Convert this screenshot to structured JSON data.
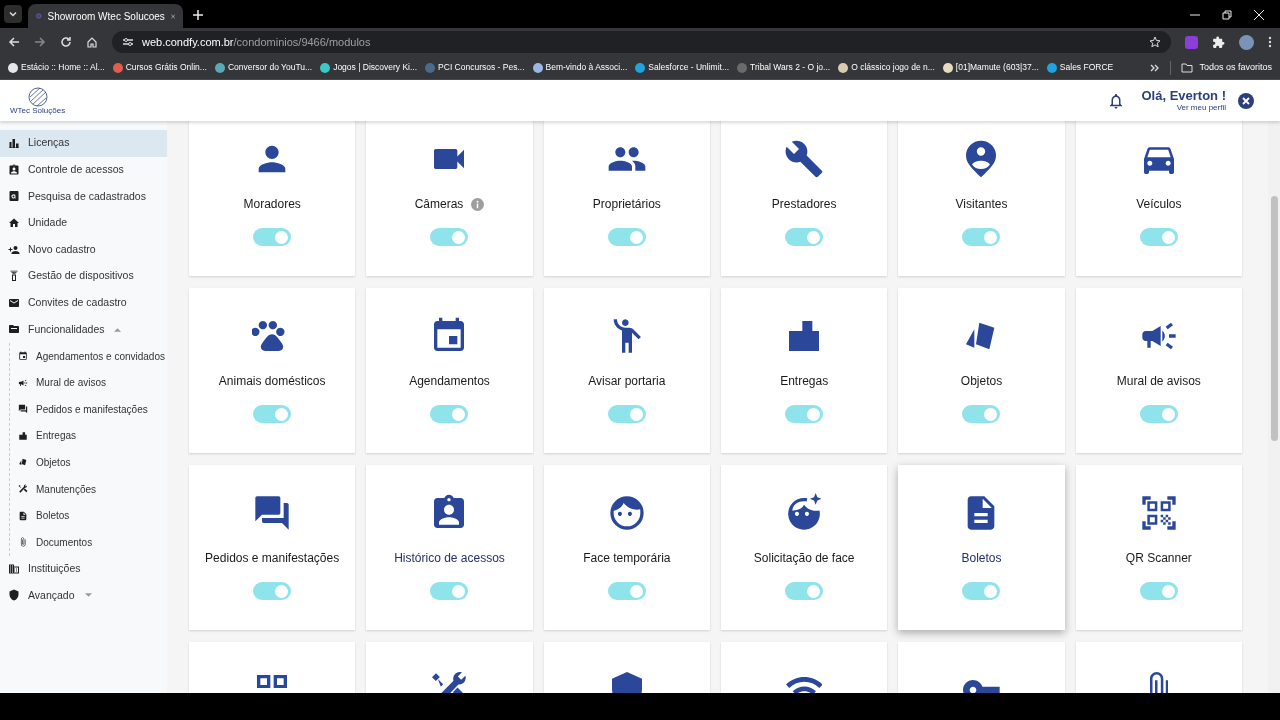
{
  "browser": {
    "tab_title": "Showroom Wtec Solucoes",
    "url_host": "web.condfy.com.br",
    "url_path": "/condominios/9466/modulos",
    "bookmarks": [
      {
        "label": "Estácio :: Home :: Al...",
        "color": "#e5e7eb"
      },
      {
        "label": "Cursos Grátis Onlin...",
        "color": "#e35d4f"
      },
      {
        "label": "Conversor do YouTu...",
        "color": "#5aa9b8"
      },
      {
        "label": "Jogos | Discovery Ki...",
        "color": "#3cc8c8"
      },
      {
        "label": "PCI Concursos - Pes...",
        "color": "#4a6b8a"
      },
      {
        "label": "Bem-vindo à Associ...",
        "color": "#9bb6e6"
      },
      {
        "label": "Salesforce - Unlimit...",
        "color": "#1ea5e0"
      },
      {
        "label": "Tribal Wars 2 - O jo...",
        "color": "#6b6b6b"
      },
      {
        "label": "O clássico jogo de n...",
        "color": "#d8cbb0"
      },
      {
        "label": "[01]Mamute (603|37...",
        "color": "#e8dcc0"
      },
      {
        "label": "Sales FORCE",
        "color": "#1ea5e0"
      }
    ],
    "all_bookmarks": "Todos os favoritos"
  },
  "header": {
    "logo_text": "WTec Soluções",
    "greeting": "Olá, Everton !",
    "profile_link": "Ver meu perfil"
  },
  "sidebar": {
    "items": [
      {
        "label": "Licenças",
        "kind": "chart",
        "selected": true
      },
      {
        "label": "Controle de acessos",
        "kind": "badge",
        "selected": false
      },
      {
        "label": "Pesquisa de cadastrados",
        "kind": "search_doc",
        "selected": false
      },
      {
        "label": "Unidade",
        "kind": "home",
        "selected": false
      },
      {
        "label": "Novo cadastro",
        "kind": "person_add",
        "selected": false
      },
      {
        "label": "Gestão de dispositivos",
        "kind": "device",
        "selected": false
      },
      {
        "label": "Convites de cadastro",
        "kind": "mail",
        "selected": false
      },
      {
        "label": "Funcionalidades",
        "kind": "folder",
        "selected": false,
        "expanded": true,
        "children": [
          {
            "label": "Agendamentos e convidados",
            "kind": "event",
            "selected": false
          },
          {
            "label": "Mural de avisos",
            "kind": "campaign",
            "selected": false
          },
          {
            "label": "Pedidos e manifestações",
            "kind": "forum",
            "selected": false
          },
          {
            "label": "Entregas",
            "kind": "package",
            "selected": false
          },
          {
            "label": "Objetos",
            "kind": "objects",
            "selected": false
          },
          {
            "label": "Manutenções",
            "kind": "tools",
            "selected": false
          },
          {
            "label": "Boletos",
            "kind": "doc",
            "selected": false
          },
          {
            "label": "Documentos",
            "kind": "clip",
            "selected": false
          }
        ]
      },
      {
        "label": "Instituições",
        "kind": "building",
        "selected": false
      },
      {
        "label": "Avançado",
        "kind": "shield",
        "selected": false,
        "expanded": false
      }
    ]
  },
  "modules": [
    {
      "label": "Moradores",
      "kind": "person",
      "on": true,
      "info": false,
      "accent": false,
      "hovered": false
    },
    {
      "label": "Câmeras",
      "kind": "videocam",
      "on": true,
      "info": true,
      "accent": false,
      "hovered": false
    },
    {
      "label": "Proprietários",
      "kind": "people",
      "on": true,
      "info": false,
      "accent": false,
      "hovered": false
    },
    {
      "label": "Prestadores",
      "kind": "wrench",
      "on": true,
      "info": false,
      "accent": false,
      "hovered": false
    },
    {
      "label": "Visitantes",
      "kind": "visitor",
      "on": true,
      "info": false,
      "accent": false,
      "hovered": false
    },
    {
      "label": "Veículos",
      "kind": "car",
      "on": true,
      "info": false,
      "accent": false,
      "hovered": false
    },
    {
      "label": "Animais domésticos",
      "kind": "paw",
      "on": true,
      "info": false,
      "accent": false,
      "hovered": false
    },
    {
      "label": "Agendamentos",
      "kind": "event",
      "on": true,
      "info": false,
      "accent": false,
      "hovered": false
    },
    {
      "label": "Avisar portaria",
      "kind": "wave",
      "on": true,
      "info": false,
      "accent": false,
      "hovered": false
    },
    {
      "label": "Entregas",
      "kind": "package",
      "on": true,
      "info": false,
      "accent": false,
      "hovered": false
    },
    {
      "label": "Objetos",
      "kind": "objects",
      "on": true,
      "info": false,
      "accent": false,
      "hovered": false
    },
    {
      "label": "Mural de avisos",
      "kind": "campaign",
      "on": true,
      "info": false,
      "accent": false,
      "hovered": false
    },
    {
      "label": "Pedidos e manifestações",
      "kind": "forum",
      "on": true,
      "info": false,
      "accent": false,
      "hovered": false
    },
    {
      "label": "Histórico de acessos",
      "kind": "badge",
      "on": true,
      "info": false,
      "accent": true,
      "hovered": false
    },
    {
      "label": "Face temporária",
      "kind": "face",
      "on": true,
      "info": false,
      "accent": false,
      "hovered": false
    },
    {
      "label": "Solicitação de face",
      "kind": "face_star",
      "on": true,
      "info": false,
      "accent": false,
      "hovered": false
    },
    {
      "label": "Boletos",
      "kind": "doc",
      "on": true,
      "info": false,
      "accent": true,
      "hovered": true
    },
    {
      "label": "QR Scanner",
      "kind": "qr",
      "on": true,
      "info": false,
      "accent": false,
      "hovered": false
    }
  ],
  "modules_cut_off": [
    {
      "kind": "grid"
    },
    {
      "kind": "tools"
    },
    {
      "kind": "shield"
    },
    {
      "kind": "wifi"
    },
    {
      "kind": "key"
    },
    {
      "kind": "clip"
    }
  ]
}
